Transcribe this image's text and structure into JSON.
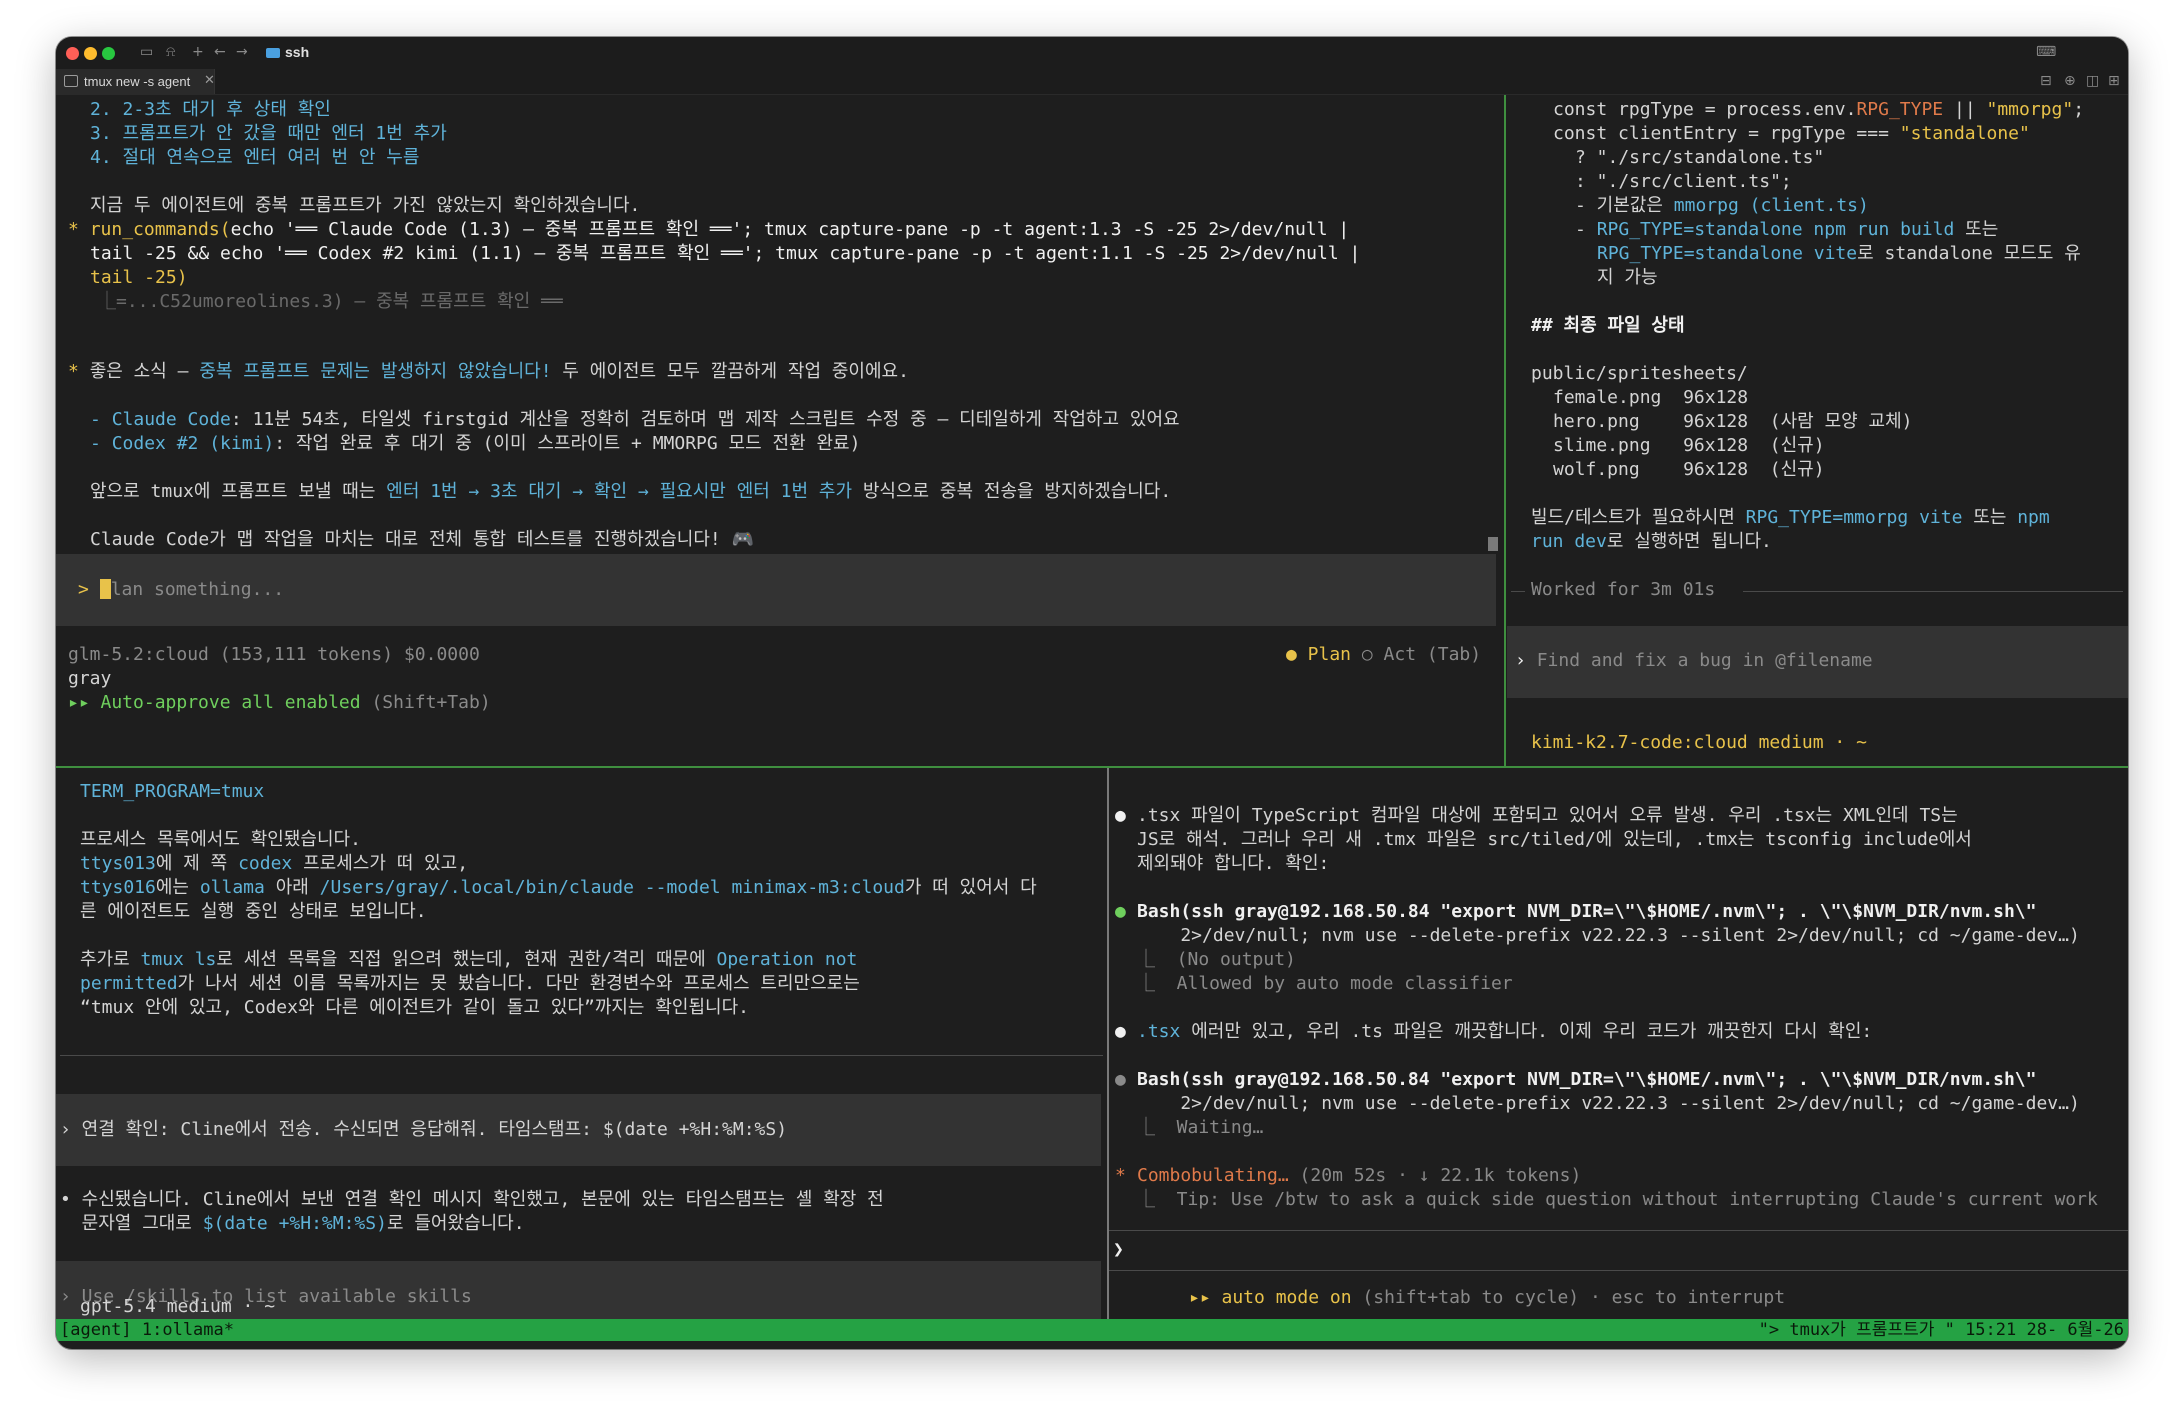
{
  "titlebar": {
    "tab_title": "ssh"
  },
  "tab": {
    "label": "tmux new -s agent"
  },
  "pane1": {
    "lines": [
      [
        "2. ",
        "2-3초 대기 후 상태 확인"
      ],
      [
        "3. ",
        "프롬프트가 안 갔을 때만 엔터 1번 추가"
      ],
      [
        "4. ",
        "절대 연속으로 엔터 여러 번 안 누름"
      ]
    ],
    "line_check": "지금 두 에이전트에 중복 프롬프트가 가진 않았는지 확인하겠습니다.",
    "cmd1_name": "run_commands(",
    "cmd1_rest": "echo '══ Claude Code (1.3) — 중복 프롬프트 확인 ══'; tmux capture-pane -p -t agent:1.3 -S -25 2>/dev/null |",
    "cmd2": "tail -25 && echo '══ Codex #2 kimi (1.1) — 중복 프롬프트 확인 ══'; tmux capture-pane -p -t agent:1.1 -S -25 2>/dev/null |",
    "cmd3": "tail -25)",
    "cmd4": "⎿=...C52umoreolines.3) — 중복 프롬프트 확인 ══",
    "good_prefix": "좋은 소식 — ",
    "good_blue": "중복 프롬프트 문제는 발생하지 않았습니다!",
    "good_suffix": " 두 에이전트 모두 깔끔하게 작업 중이에요.",
    "b1_label": "Claude Code",
    "b1_text": ": 11분 54초, 타일셋 firstgid 계산을 정확히 검토하며 맵 제작 스크립트 수정 중 — 디테일하게 작업하고 있어요",
    "b2_label": "Codex #2 (kimi)",
    "b2_text": ": 작업 완료 후 대기 중 (이미 스프라이트 + MMORPG 모드 전환 완료)",
    "future_prefix": "앞으로 tmux에 프롬프트 보낼 때는 ",
    "future_blue": "엔터 1번 → 3초 대기 → 확인 → 필요시만 엔터 1번 추가",
    "future_suffix": " 방식으로 중복 전송을 방지하겠습니다.",
    "claude_line": "Claude Code가 맵 작업을 마치는 대로 전체 통합 테스트를 진행하겠습니다! 🎮",
    "input_placeholder": "lan something...",
    "model_line": "glm-5.2:cloud (153,111 tokens) $0.0000",
    "plan": "● Plan",
    "act": "○ Act (Tab)",
    "user": "gray",
    "auto_approve": "▸▸ Auto-approve all enabled",
    "auto_hint": " (Shift+Tab)"
  },
  "pane2": {
    "l1a": "const rpgType = process.env.",
    "l1b": "RPG_TYPE",
    "l1c": " || ",
    "l1d": "\"mmorpg\"",
    "l1e": ";",
    "l2a": "const clientEntry = rpgType === ",
    "l2b": "\"standalone\"",
    "l3": "? \"./src/standalone.ts\"",
    "l4": ": \"./src/client.ts\";",
    "l5a": "- 기본값은 ",
    "l5b": "mmorpg (client.ts)",
    "l6a": "- ",
    "l6b": "RPG_TYPE=standalone npm run build",
    "l6c": " 또는",
    "l7a": "RPG_TYPE=standalone vite",
    "l7b": "로 standalone 모드도 유",
    "l8": "지 가능",
    "heading": "## 최종 파일 상태",
    "dir": "public/spritesheets/",
    "files": [
      {
        "name": "female.png",
        "size": "96x128",
        "note": ""
      },
      {
        "name": "hero.png",
        "size": "96x128",
        "note": "(사람 모양 교체)"
      },
      {
        "name": "slime.png",
        "size": "96x128",
        "note": "(신규)"
      },
      {
        "name": "wolf.png",
        "size": "96x128",
        "note": "(신규)"
      }
    ],
    "build_a": "빌드/테스트가 필요하시면 ",
    "build_b": "RPG_TYPE=mmorpg vite",
    "build_c": " 또는 ",
    "build_d": "npm",
    "build2_a": "run dev",
    "build2_b": "로 실행하면 됩니다.",
    "worked": "Worked for 3m 01s",
    "input_placeholder": "Find and fix a bug in @filename",
    "model": "kimi-k2.7-code:cloud medium · ~"
  },
  "pane3": {
    "env": "TERM_PROGRAM=tmux",
    "p1": "프로세스 목록에서도 확인됐습니다.",
    "p2a": "ttys013",
    "p2b": "에 제 쪽 ",
    "p2c": "codex",
    "p2d": " 프로세스가 떠 있고,",
    "p3a": "ttys016",
    "p3b": "에는 ",
    "p3c": "ollama",
    "p3d": " 아래 ",
    "p3e": "/Users/gray/.local/bin/claude --model minimax-m3:cloud",
    "p3f": "가 떠 있어서 다",
    "p4": "른 에이전트도 실행 중인 상태로 보입니다.",
    "p5a": "추가로 ",
    "p5b": "tmux ls",
    "p5c": "로 세션 목록을 직접 읽으려 했는데, 현재 권한/격리 때문에 ",
    "p5d": "Operation not",
    "p6a": "permitted",
    "p6b": "가 나서 세션 이름 목록까지는 못 봤습니다. 다만 환경변수와 프로세스 트리만으로는",
    "p7": "“tmux 안에 있고, Codex와 다른 에이전트가 같이 돌고 있다”까지는 확인됩니다.",
    "user_msg": "› 연결 확인: Cline에서 전송. 수신되면 응답해줘. 타임스탬프: $(date +%H:%M:%S)",
    "reply1": "• 수신됐습니다. Cline에서 보낸 연결 확인 메시지 확인했고, 본문에 있는 타임스탬프는 셸 확장 전",
    "reply2a": "  문자열 그대로 ",
    "reply2b": "$(date +%H:%M:%S)",
    "reply2c": "로 들어왔습니다.",
    "input_placeholder": "› Use /skills to list available skills",
    "model": "gpt-5.4 medium · ~"
  },
  "pane4": {
    "b1": ".tsx 파일이 TypeScript 컴파일 대상에 포함되고 있어서 오류 발생. 우리 .tsx는 XML인데 TS는",
    "b1b": "JS로 해석. 그러나 우리 새 .tmx 파일은 src/tiled/에 있는데, .tmx는 tsconfig include에서",
    "b1c": "제외돼야 합니다. 확인:",
    "bash1a": "Bash(ssh gray@192.168.50.84 \"export NVM_DIR=\\\"\\$HOME/.nvm\\\"; . \\\"\\$NVM_DIR/nvm.sh\\\"",
    "bash1b": "    2>/dev/null; nvm use --delete-prefix v22.22.3 --silent 2>/dev/null; cd ~/game-dev…)",
    "out1": "⎿  (No output)",
    "out2": "⎿  Allowed by auto mode classifier",
    "b2a": ".tsx",
    "b2b": " 에러만 있고, 우리 .ts 파일은 깨끗합니다. 이제 우리 코드가 깨끗한지 다시 확인:",
    "bash2a": "Bash(ssh gray@192.168.50.84 \"export NVM_DIR=\\\"\\$HOME/.nvm\\\"; . \\\"\\$NVM_DIR/nvm.sh\\\"",
    "bash2b": "    2>/dev/null; nvm use --delete-prefix v22.22.3 --silent 2>/dev/null; cd ~/game-dev…)",
    "waiting": "⎿  Waiting…",
    "combob": "Combobulating…",
    "combob_meta": " (20m 52s · ↓ 22.1k tokens)",
    "tip": "⎿  Tip: Use /btw to ask a quick side question without interrupting Claude's current work",
    "prompt": "❯",
    "auto_mode": "▸▸ auto mode on",
    "auto_hint": " (shift+tab to cycle) · esc to interrupt"
  },
  "status": {
    "left": "[agent] 1:ollama*",
    "right": "\"> tmux가 프롬프트가 \" 15:21 28- 6월-26"
  },
  "colors": {
    "status_bg": "#25a244",
    "accent_blue": "#5fb3d9",
    "accent_yellow": "#e8c24a",
    "accent_green": "#6fcf5d"
  }
}
